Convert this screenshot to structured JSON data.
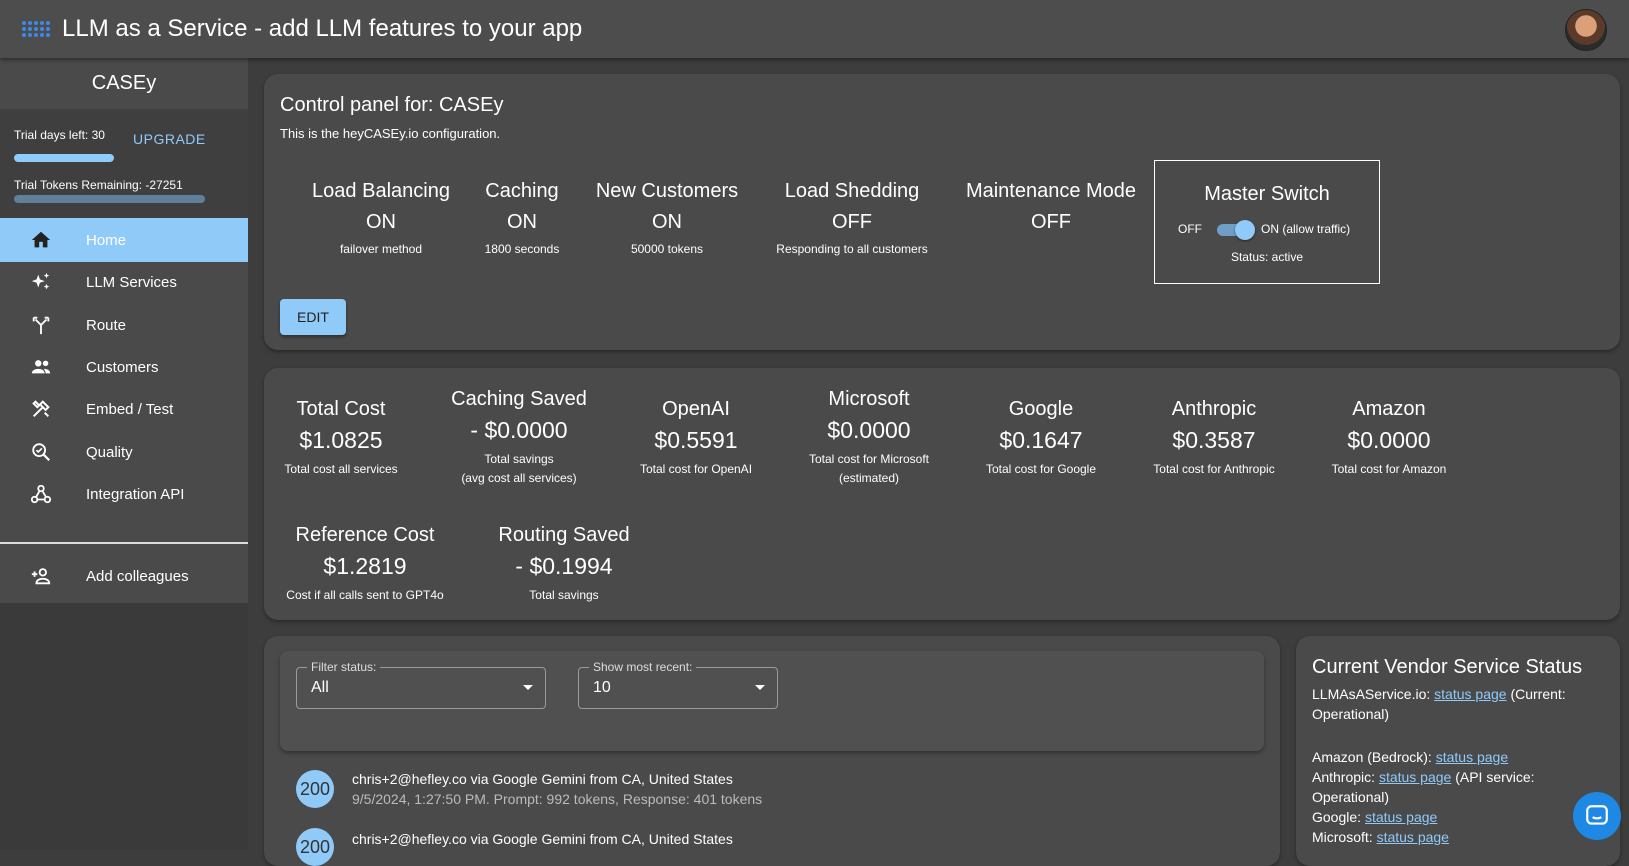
{
  "header": {
    "title": "LLM as a Service - add LLM features to your app"
  },
  "sidebar": {
    "org": "CASEy",
    "trial_days": "Trial days left: 30",
    "trial_days_fraction": 0.33,
    "upgrade": "UPGRADE",
    "trial_tokens": "Trial Tokens Remaining: -27251",
    "nav": [
      {
        "label": "Home",
        "icon": "home-icon",
        "active": true
      },
      {
        "label": "LLM Services",
        "icon": "sparkle-icon"
      },
      {
        "label": "Route",
        "icon": "route-icon"
      },
      {
        "label": "Customers",
        "icon": "people-icon"
      },
      {
        "label": "Embed / Test",
        "icon": "tools-icon"
      },
      {
        "label": "Quality",
        "icon": "quality-search-icon"
      },
      {
        "label": "Integration API",
        "icon": "webhook-icon"
      }
    ],
    "add_colleagues": "Add colleagues"
  },
  "control": {
    "title": "Control panel for: CASEy",
    "subtitle": "This is the heyCASEy.io configuration.",
    "settings": [
      {
        "name": "Load Balancing",
        "value": "ON",
        "detail": "failover method"
      },
      {
        "name": "Caching",
        "value": "ON",
        "detail": "1800 seconds"
      },
      {
        "name": "New Customers",
        "value": "ON",
        "detail": "50000 tokens"
      },
      {
        "name": "Load Shedding",
        "value": "OFF",
        "detail": "Responding to all customers"
      },
      {
        "name": "Maintenance Mode",
        "value": "OFF",
        "detail": ""
      }
    ],
    "master": {
      "title": "Master Switch",
      "off": "OFF",
      "on": "ON (allow traffic)",
      "status": "Status: active"
    },
    "edit": "EDIT"
  },
  "costs": {
    "items": [
      {
        "name": "Total Cost",
        "value": "$1.0825",
        "detail": "Total cost all services"
      },
      {
        "name": "Caching Saved",
        "value": "- $0.0000",
        "detail": "Total savings",
        "detail2": "(avg cost all services)"
      },
      {
        "name": "OpenAI",
        "value": "$0.5591",
        "detail": "Total cost for OpenAI"
      },
      {
        "name": "Microsoft",
        "value": "$0.0000",
        "detail": "Total cost for Microsoft",
        "detail2": "(estimated)"
      },
      {
        "name": "Google",
        "value": "$0.1647",
        "detail": "Total cost for Google"
      },
      {
        "name": "Anthropic",
        "value": "$0.3587",
        "detail": "Total cost for Anthropic"
      },
      {
        "name": "Amazon",
        "value": "$0.0000",
        "detail": "Total cost for Amazon"
      },
      {
        "name": "Reference Cost",
        "value": "$1.2819",
        "detail": "Cost if all calls sent to GPT4o"
      },
      {
        "name": "Routing Saved",
        "value": "- $0.1994",
        "detail": "Total savings"
      }
    ]
  },
  "logs": {
    "filter_label": "Filter status:",
    "filter_value": "All",
    "recent_label": "Show most recent:",
    "recent_value": "10",
    "entries": [
      {
        "code": "200",
        "line1": "chris+2@hefley.co via Google Gemini from CA, United States",
        "line2": "9/5/2024, 1:27:50 PM. Prompt: 992 tokens, Response: 401 tokens"
      },
      {
        "code": "200",
        "line1": "chris+2@hefley.co via Google Gemini from CA, United States",
        "line2": ""
      }
    ]
  },
  "vendor": {
    "title": "Current Vendor Service Status",
    "link": "status page",
    "llmas_prefix": "LLMAsAService.io: ",
    "llmas_suffix": " (Current: Operational)",
    "amazon_prefix": "Amazon (Bedrock): ",
    "anthropic_prefix": "Anthropic: ",
    "anthropic_suffix": " (API service: Operational)",
    "google_prefix": "Google: ",
    "microsoft_prefix": "Microsoft: "
  }
}
